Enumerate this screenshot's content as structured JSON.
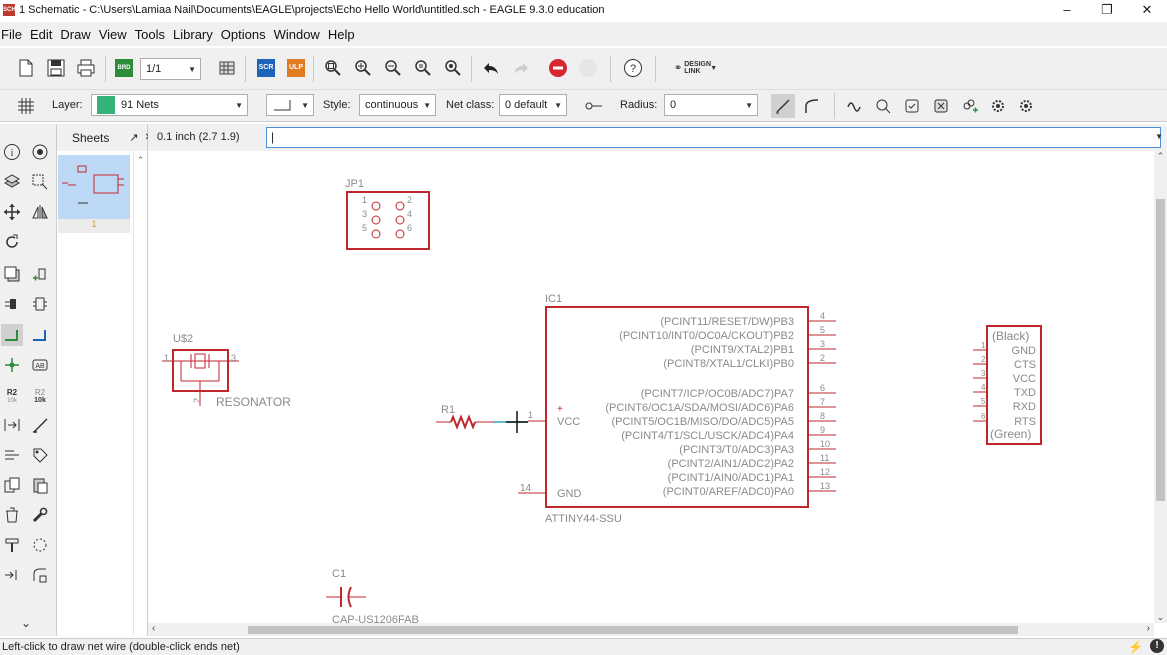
{
  "window": {
    "title": "1 Schematic - C:\\Users\\Lamiaa Nail\\Documents\\EAGLE\\projects\\Echo Hello World\\untitled.sch - EAGLE 9.3.0 education",
    "icon_text": "SCH",
    "minimize": "–",
    "maximize": "❐",
    "close": "✕"
  },
  "menu": [
    "File",
    "Edit",
    "Draw",
    "View",
    "Tools",
    "Library",
    "Options",
    "Window",
    "Help"
  ],
  "toolbar": {
    "sheet_select": "1/1",
    "brd_label": "BRD",
    "scr_label": "SCR",
    "ulp_label": "ULP",
    "design_link": "DESIGN LINK"
  },
  "params": {
    "layer_label": "Layer:",
    "layer_value": "91 Nets",
    "layer_color": "#33b37a",
    "style_label": "Style:",
    "style_value": "continuous",
    "netclass_label": "Net class:",
    "netclass_value": "0 default",
    "radius_label": "Radius:",
    "radius_value": "0"
  },
  "sheets_panel": {
    "title": "Sheets",
    "pin_icon": "↗",
    "close_icon": "✕",
    "sheet_number": "1"
  },
  "command": {
    "coordinate": "0.1 inch (2.7 1.9)",
    "input_value": "|"
  },
  "schematic": {
    "jp1": {
      "name": "JP1",
      "pins": [
        "1",
        "2",
        "3",
        "4",
        "5",
        "6"
      ]
    },
    "ic1": {
      "name": "IC1",
      "value": "ATTINY44-SSU",
      "right_pins": [
        {
          "label": "(PCINT11/RESET/DW)PB3",
          "num": "4"
        },
        {
          "label": "(PCINT10/INT0/OC0A/CKOUT)PB2",
          "num": "5"
        },
        {
          "label": "(PCINT9/XTAL2)PB1",
          "num": "3"
        },
        {
          "label": "(PCINT8/XTAL1/CLKI)PB0",
          "num": "2"
        },
        {
          "label": "(PCINT7/ICP/OC0B/ADC7)PA7",
          "num": "6"
        },
        {
          "label": "(PCINT6/OC1A/SDA/MOSI/ADC6)PA6",
          "num": "7"
        },
        {
          "label": "(PCINT5/OC1B/MISO/DO/ADC5)PA5",
          "num": "8"
        },
        {
          "label": "(PCINT4/T1/SCL/USCK/ADC4)PA4",
          "num": "9"
        },
        {
          "label": "(PCINT3/T0/ADC3)PA3",
          "num": "10"
        },
        {
          "label": "(PCINT2/AIN1/ADC2)PA2",
          "num": "11"
        },
        {
          "label": "(PCINT1/AIN0/ADC1)PA1",
          "num": "12"
        },
        {
          "label": "(PCINT0/AREF/ADC0)PA0",
          "num": "13"
        }
      ],
      "vcc_label": "VCC",
      "vcc_pin": "1",
      "gnd_label": "GND",
      "gnd_pin": "14",
      "plus": "+"
    },
    "us2": {
      "name": "U$2",
      "value": "RESONATOR",
      "pin1": "1",
      "pin2": "2",
      "pin3": "3"
    },
    "r1": {
      "name": "R1"
    },
    "c1": {
      "name": "C1",
      "value": "CAP-US1206FAB"
    },
    "ftdi": {
      "top": "(Black)",
      "pins": [
        "GND",
        "CTS",
        "VCC",
        "TXD",
        "RXD",
        "RTS"
      ],
      "pin_nums": [
        "1",
        "2",
        "3",
        "4",
        "5",
        "6"
      ],
      "bottom": "(Green)"
    },
    "colors": {
      "symbol": "#c0272d",
      "text": "#8a8a8a",
      "pin": "#c0272d",
      "wire": "#2aa3b8"
    }
  },
  "status": {
    "text": "Left-click to draw net wire (double-click ends net)"
  }
}
